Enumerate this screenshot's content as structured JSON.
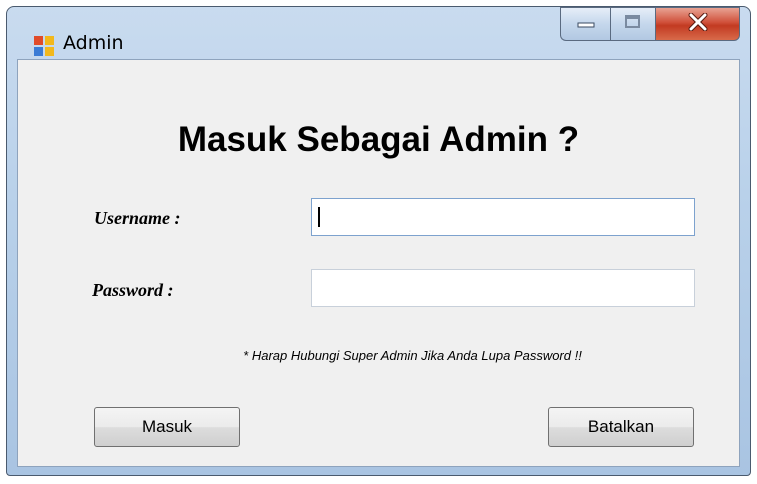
{
  "window": {
    "title": "Admin",
    "icon": "app-form-icon",
    "caption_buttons": [
      "minimize-icon",
      "maximize-icon",
      "close-icon"
    ]
  },
  "form": {
    "heading": "Masuk Sebagai Admin ?",
    "username_label": "Username :",
    "username_value": "",
    "password_label": "Password  :",
    "password_value": "",
    "note": "* Harap Hubungi Super Admin Jika Anda Lupa Password !!",
    "login_button": "Masuk",
    "cancel_button": "Batalkan"
  }
}
